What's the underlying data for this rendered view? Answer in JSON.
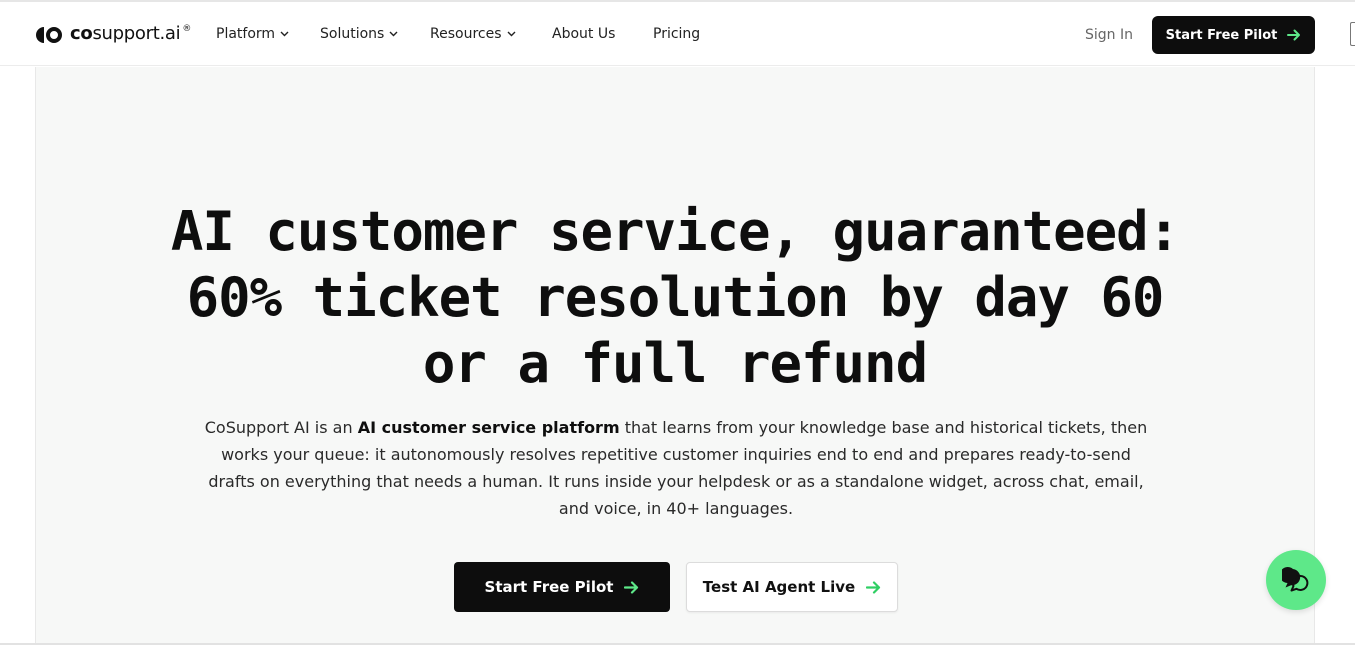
{
  "nav": {
    "logo": {
      "prefix": "co",
      "rest": "support.ai",
      "reg": "®"
    },
    "items": [
      {
        "label": "Platform",
        "has_dropdown": true
      },
      {
        "label": "Solutions",
        "has_dropdown": true
      },
      {
        "label": "Resources",
        "has_dropdown": true
      },
      {
        "label": "About Us",
        "has_dropdown": false
      },
      {
        "label": "Pricing",
        "has_dropdown": false
      }
    ],
    "sign_in": "Sign In",
    "cta": {
      "label": "Start Free Pilot",
      "icon": "arrow-right-icon",
      "accent": "#5ee889"
    }
  },
  "hero": {
    "title_lines": [
      "AI customer service, guaranteed:",
      "60% ticket resolution by day 60",
      "or a full refund"
    ],
    "description": {
      "intro": "CoSupport AI is an ",
      "bold": "AI customer service platform",
      "rest": " that learns from your knowledge base and historical tickets, then works your queue: it autonomously resolves repetitive customer inquiries end to end and prepares ready-to-send drafts on everything that needs a human. It runs inside your helpdesk or as a standalone widget, across chat, email, and voice, in 40+ languages."
    },
    "primary_button": {
      "label": "Start Free Pilot",
      "icon": "arrow-right-icon"
    },
    "secondary_button": {
      "label": "Test AI Agent Live",
      "icon": "arrow-right-icon"
    }
  },
  "chat_widget": {
    "icon": "chat-bubbles-icon",
    "color": "#5ee889"
  },
  "colors": {
    "dark": "#0d0d0d",
    "accent_green": "#5ee889",
    "hero_bg": "#f7f8f7"
  }
}
